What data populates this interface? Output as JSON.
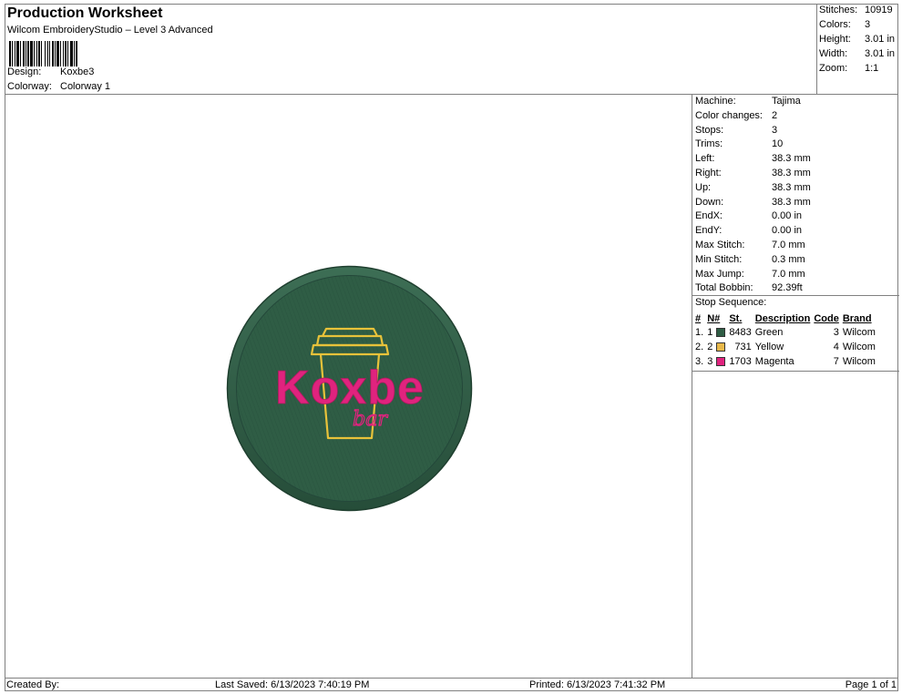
{
  "header": {
    "title": "Production Worksheet",
    "subtitle": "Wilcom EmbroideryStudio – Level 3 Advanced",
    "design_label": "Design:",
    "design_value": "Koxbe3",
    "colorway_label": "Colorway:",
    "colorway_value": "Colorway 1"
  },
  "summary": {
    "stitches_label": "Stitches:",
    "stitches_value": "10919",
    "colors_label": "Colors:",
    "colors_value": "3",
    "height_label": "Height:",
    "height_value": "3.01 in",
    "width_label": "Width:",
    "width_value": "3.01 in",
    "zoom_label": "Zoom:",
    "zoom_value": "1:1"
  },
  "design": {
    "logo_main": "Koxbe",
    "logo_sub": "bar",
    "colors": {
      "green": "#2f5d45",
      "yellow": "#e8c23a",
      "magenta": "#e0237e"
    }
  },
  "info": {
    "rows": [
      {
        "label": "Machine:",
        "value": "Tajima"
      },
      {
        "label": "Color changes:",
        "value": "2"
      },
      {
        "label": "Stops:",
        "value": "3"
      },
      {
        "label": "Trims:",
        "value": "10"
      },
      {
        "label": "Left:",
        "value": "38.3 mm"
      },
      {
        "label": "Right:",
        "value": "38.3 mm"
      },
      {
        "label": "Up:",
        "value": "38.3 mm"
      },
      {
        "label": "Down:",
        "value": "38.3 mm"
      },
      {
        "label": "EndX:",
        "value": "0.00 in"
      },
      {
        "label": "EndY:",
        "value": "0.00 in"
      },
      {
        "label": "Max Stitch:",
        "value": "7.0 mm"
      },
      {
        "label": "Min Stitch:",
        "value": "0.3 mm"
      },
      {
        "label": "Max Jump:",
        "value": "7.0 mm"
      },
      {
        "label": "Total Bobbin:",
        "value": "92.39ft"
      }
    ],
    "stop_sequence_label": "Stop Sequence:",
    "stop_headers": [
      "#",
      "N#",
      "St.",
      "Description",
      "Code",
      "Brand"
    ],
    "stops": [
      {
        "idx": "1.",
        "n": "1",
        "color": "#2f5d45",
        "st": "8483",
        "desc": "Green",
        "code": "3",
        "brand": "Wilcom"
      },
      {
        "idx": "2.",
        "n": "2",
        "color": "#e8b84a",
        "st": "731",
        "desc": "Yellow",
        "code": "4",
        "brand": "Wilcom"
      },
      {
        "idx": "3.",
        "n": "3",
        "color": "#e0237e",
        "st": "1703",
        "desc": "Magenta",
        "code": "7",
        "brand": "Wilcom"
      }
    ]
  },
  "footer": {
    "created_by": "Created By:",
    "last_saved": "Last Saved: 6/13/2023 7:40:19 PM",
    "printed": "Printed: 6/13/2023 7:41:32 PM",
    "page": "Page 1 of 1"
  }
}
